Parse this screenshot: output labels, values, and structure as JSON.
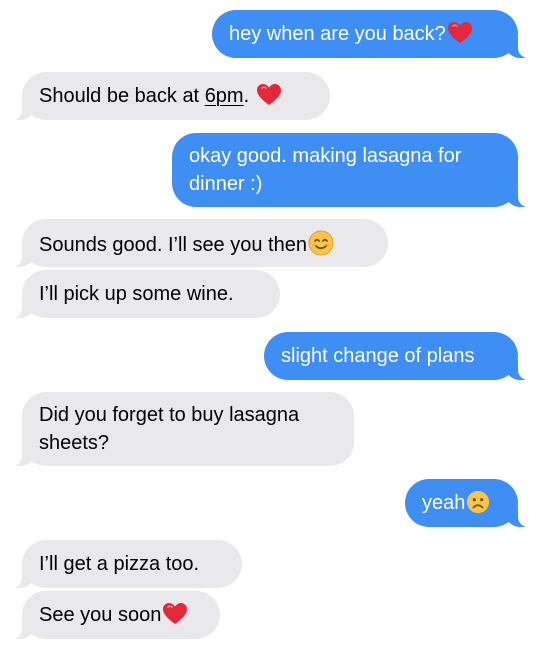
{
  "conversation": {
    "messages": [
      {
        "sender": "me",
        "text": "hey when are you back?",
        "emoji": "red-heart"
      },
      {
        "sender": "them",
        "text_before": "Should be back at ",
        "link": "6pm",
        "text_after": ".",
        "emoji": "red-heart"
      },
      {
        "sender": "me",
        "text": "okay good. making lasagna for dinner :)"
      },
      {
        "sender": "them",
        "text": "Sounds good. I’ll see you then",
        "emoji": "smiling-face"
      },
      {
        "sender": "them",
        "text": "I’ll pick up some wine."
      },
      {
        "sender": "me",
        "text": "slight change of plans"
      },
      {
        "sender": "them",
        "text": "Did you forget to buy lasagna sheets?"
      },
      {
        "sender": "me",
        "text": "yeah",
        "emoji": "frowning-face"
      },
      {
        "sender": "them",
        "text": "I’ll get a pizza too."
      },
      {
        "sender": "them",
        "text": "See you soon",
        "emoji": "red-heart"
      }
    ]
  },
  "colors": {
    "outgoing_bubble": "#3e8ef3",
    "incoming_bubble": "#e9e9eb",
    "outgoing_text": "#ffffff",
    "incoming_text": "#000000",
    "heart": "#e4283c",
    "emoji_face": "#f7c54a"
  }
}
